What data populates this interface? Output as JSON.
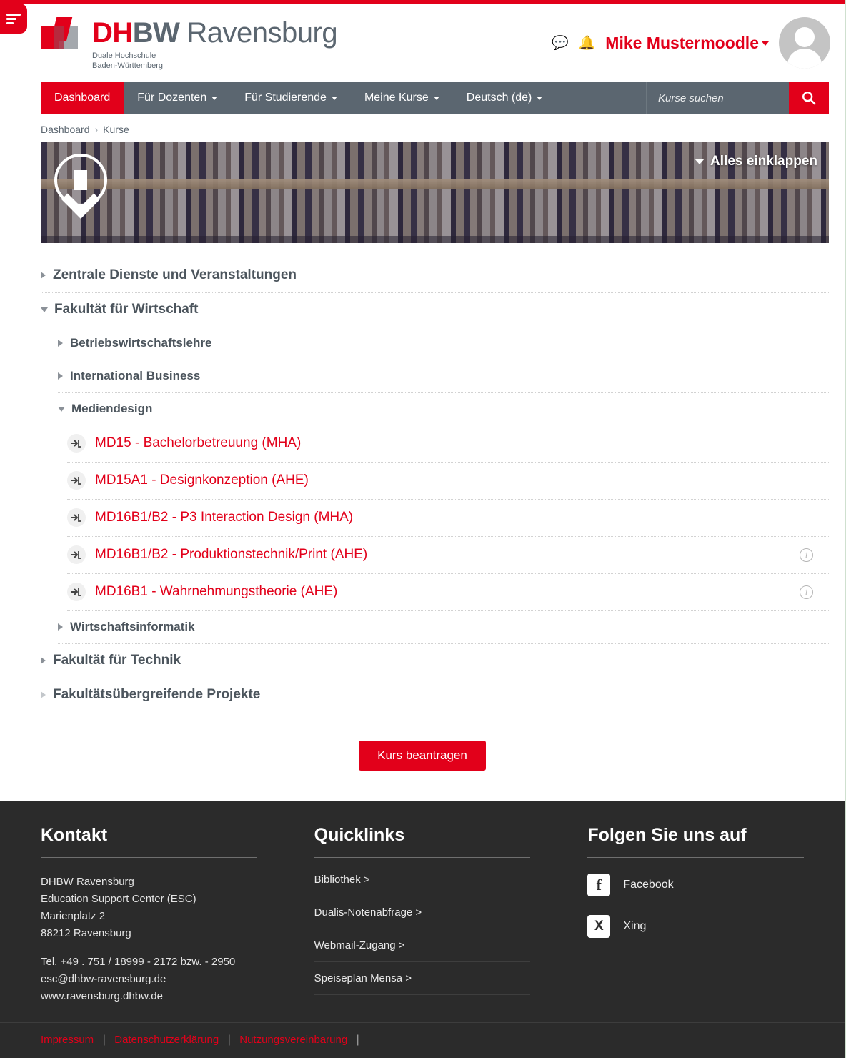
{
  "topbar": {
    "menu_icon": "menu-lines-icon"
  },
  "header": {
    "logo": {
      "abbr_red": "DH",
      "abbr_grey": "BW",
      "city": "Ravensburg",
      "sub_line1": "Duale Hochschule",
      "sub_line2": "Baden-Württemberg"
    },
    "message_icon": "message-bubble-icon",
    "notification_icon": "bell-icon",
    "username": "Mike Mustermoodle",
    "avatar": "user-avatar-icon"
  },
  "nav": {
    "items": [
      {
        "label": "Dashboard",
        "active": true,
        "dropdown": false
      },
      {
        "label": "Für Dozenten",
        "active": false,
        "dropdown": true
      },
      {
        "label": "Für Studierende",
        "active": false,
        "dropdown": true
      },
      {
        "label": "Meine Kurse",
        "active": false,
        "dropdown": true
      },
      {
        "label": "Deutsch (de)",
        "active": false,
        "dropdown": true
      }
    ],
    "search_placeholder": "Kurse suchen",
    "search_value": "",
    "search_icon": "search-icon"
  },
  "breadcrumb": {
    "items": [
      "Dashboard",
      "Kurse"
    ],
    "separator": "›"
  },
  "banner": {
    "scroll_icon": "arrow-down-circle-icon",
    "collapse_all_label": "Alles einklappen"
  },
  "tree": [
    {
      "level": 0,
      "label": "Zentrale Dienste und Veranstaltungen",
      "state": "collapsed"
    },
    {
      "level": 0,
      "label": "Fakultät für Wirtschaft",
      "state": "expanded"
    },
    {
      "level": 1,
      "label": "Betriebswirtschaftslehre",
      "state": "collapsed"
    },
    {
      "level": 1,
      "label": "International Business",
      "state": "collapsed"
    },
    {
      "level": 1,
      "label": "Mediendesign",
      "state": "expanded"
    }
  ],
  "courses": [
    {
      "icon": "enrol-arrow-icon",
      "title": "MD15 - Bachelorbetreuung (MHA)",
      "info": false
    },
    {
      "icon": "enrol-arrow-icon",
      "title": "MD15A1 - Designkonzeption (AHE)",
      "info": false
    },
    {
      "icon": "enrol-arrow-icon",
      "title": "MD16B1/B2 - P3 Interaction Design (MHA)",
      "info": false
    },
    {
      "icon": "enrol-arrow-icon",
      "title": "MD16B1/B2 - Produktionstechnik/Print (AHE)",
      "info": true
    },
    {
      "icon": "enrol-arrow-icon",
      "title": "MD16B1 - Wahrnehmungstheorie (AHE)",
      "info": true
    }
  ],
  "tree_after": [
    {
      "level": 1,
      "label": "Wirtschaftsinformatik",
      "state": "collapsed"
    },
    {
      "level": 0,
      "label": "Fakultät für Technik",
      "state": "collapsed"
    },
    {
      "level": 0,
      "label": "Fakultätsübergreifende Projekte",
      "state": "collapsed-empty"
    }
  ],
  "request_button": {
    "label": "Kurs beantragen"
  },
  "footer": {
    "contact": {
      "heading": "Kontakt",
      "lines": [
        "DHBW Ravensburg",
        "Education Support Center (ESC)",
        "Marienplatz 2",
        "88212 Ravensburg"
      ],
      "lines2": [
        "Tel. +49 . 751 / 18999 - 2172 bzw. - 2950",
        "esc@dhbw-ravensburg.de",
        "www.ravensburg.dhbw.de"
      ]
    },
    "quicklinks": {
      "heading": "Quicklinks",
      "items": [
        "Bibliothek >",
        "Dualis-Notenabfrage >",
        "Webmail-Zugang >",
        "Speiseplan Mensa >"
      ]
    },
    "social": {
      "heading": "Folgen Sie uns auf",
      "items": [
        {
          "icon": "facebook-icon",
          "glyph": "f",
          "label": "Facebook"
        },
        {
          "icon": "xing-icon",
          "glyph": "X",
          "label": "Xing"
        }
      ]
    },
    "legal": [
      "Impressum",
      "Datenschutzerklärung",
      "Nutzungsvereinbarung"
    ],
    "legal_separator": "|"
  },
  "colors": {
    "brand_red": "#e2001a",
    "nav_grey": "#5b6670",
    "footer_bg": "#2b2b2b"
  }
}
